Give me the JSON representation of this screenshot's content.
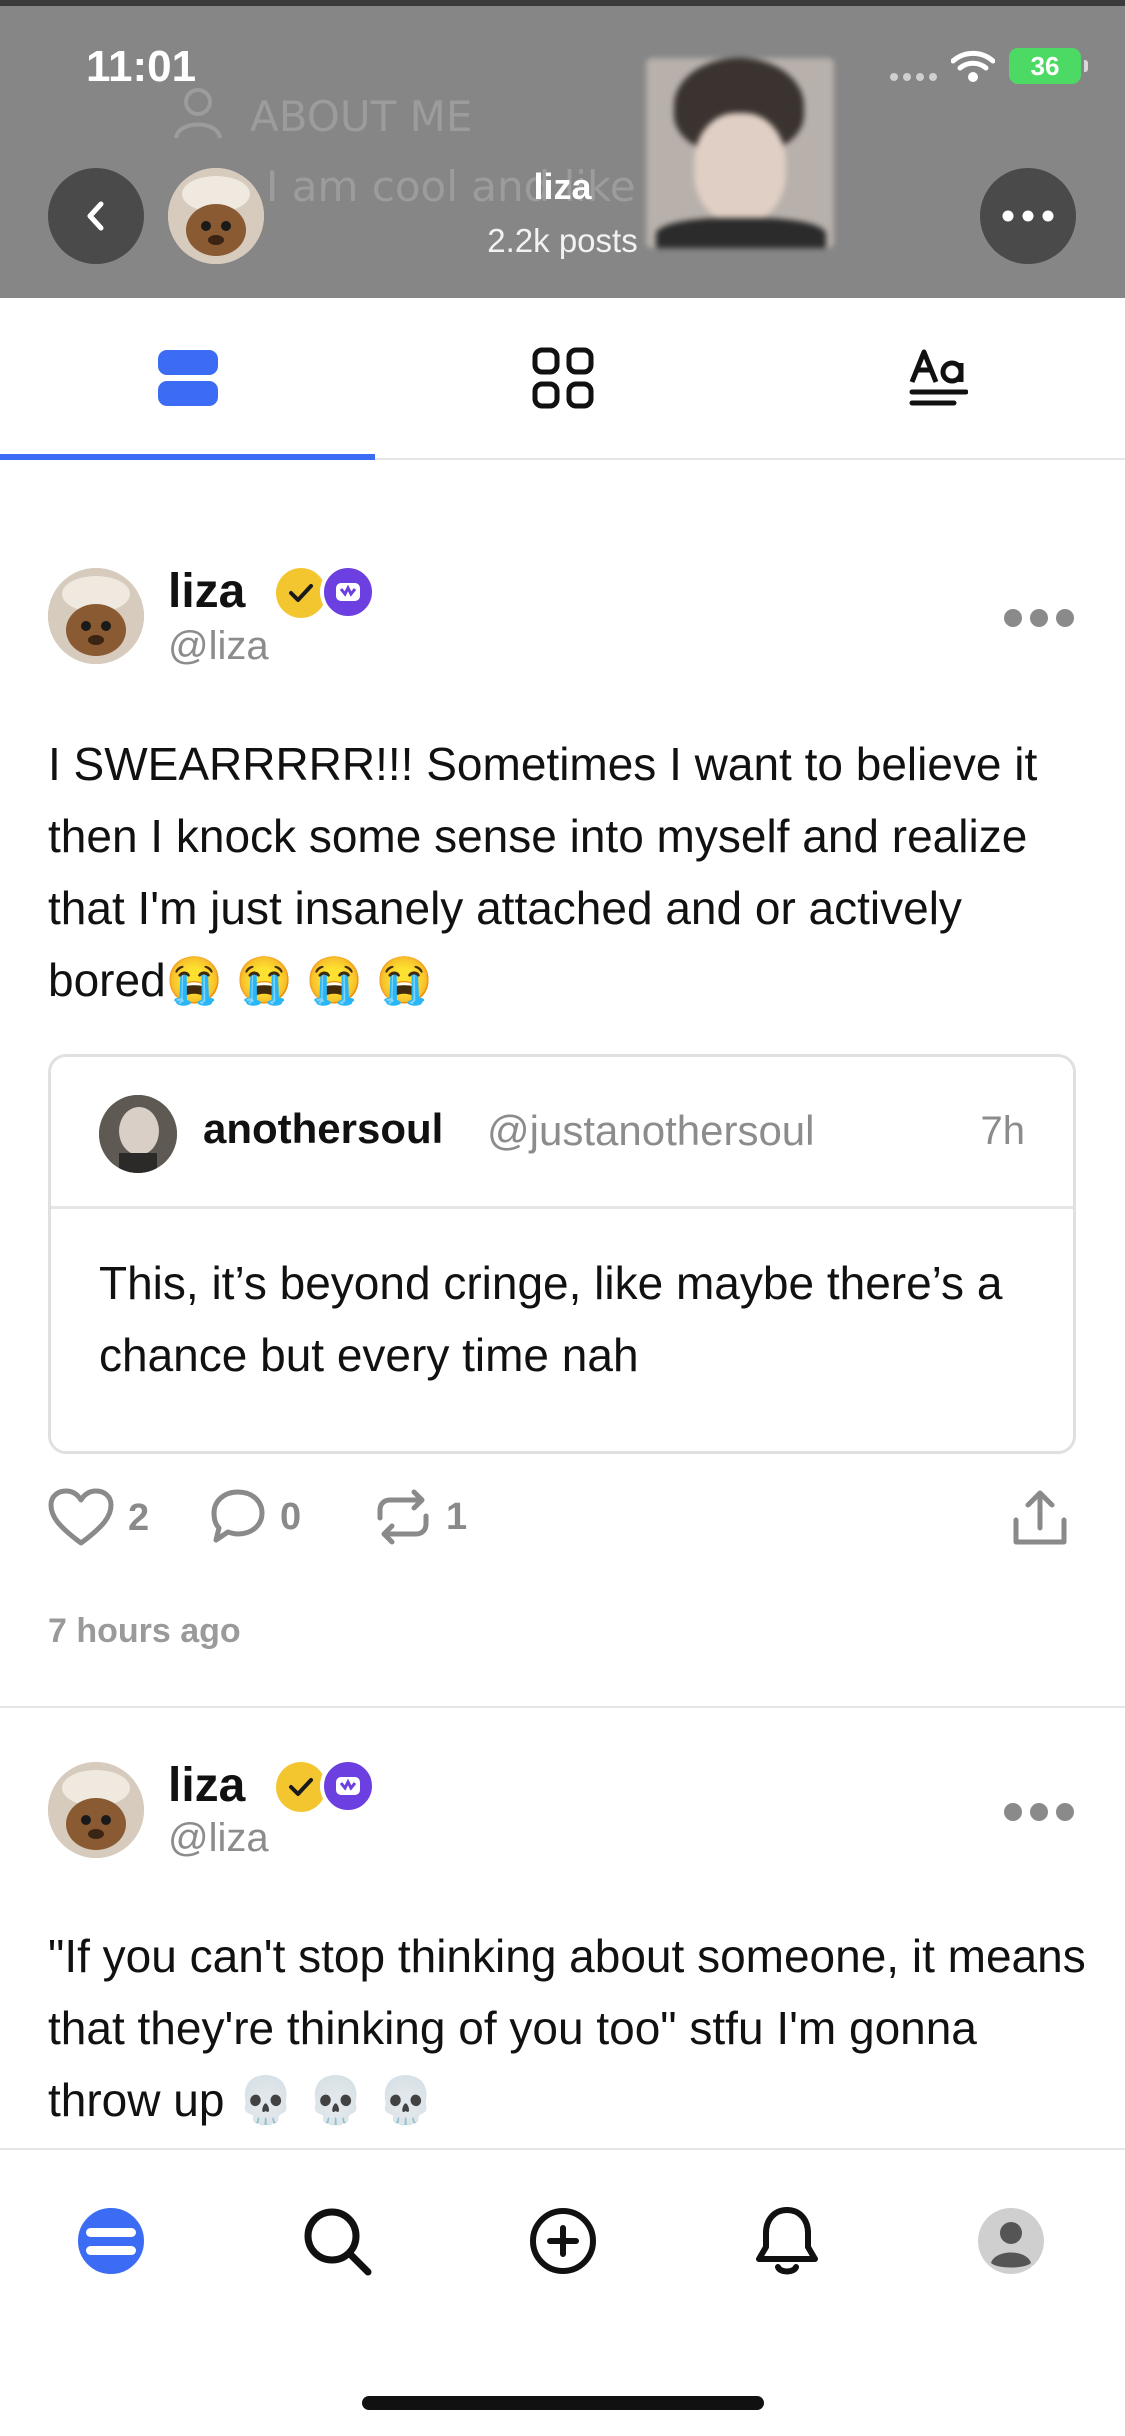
{
  "status_bar": {
    "time": "11:01",
    "battery": "36"
  },
  "banner": {
    "about_label": "ABOUT ME",
    "bio_fragment": "I am cool and like"
  },
  "header": {
    "name": "liza",
    "posts_count": "2.2k posts"
  },
  "tabs": [
    {
      "name": "posts",
      "icon": "list-view-icon",
      "active": true
    },
    {
      "name": "media",
      "icon": "grid-view-icon",
      "active": false
    },
    {
      "name": "text",
      "icon": "text-view-icon",
      "active": false
    }
  ],
  "posts": [
    {
      "author_name": "liza",
      "author_handle": "@liza",
      "text": "I SWEARRRRR!!! Sometimes I want to believe it then I knock some sense into myself and realize that I'm just insanely attached and or actively bored😭 😭 😭 😭",
      "quote": {
        "name": "anothersoul",
        "handle": "@justanothersoul",
        "time": "7h",
        "text": "This, it’s beyond cringe, like maybe there’s a chance but every time nah"
      },
      "likes": "2",
      "comments": "0",
      "reposts": "1",
      "timestamp": "7 hours ago"
    },
    {
      "author_name": "liza",
      "author_handle": "@liza",
      "text": "\"If you can't stop thinking about someone, it means that they're thinking of you too\" stfu I'm gonna throw up 💀 💀 💀"
    }
  ],
  "bottom_nav": [
    "home-icon",
    "search-icon",
    "create-post-icon",
    "notifications-icon",
    "profile-icon"
  ],
  "colors": {
    "accent": "#3b6cf3",
    "verified_badge": "#f3c630",
    "premium_badge": "#6c3fe0",
    "banner": "#868686"
  }
}
